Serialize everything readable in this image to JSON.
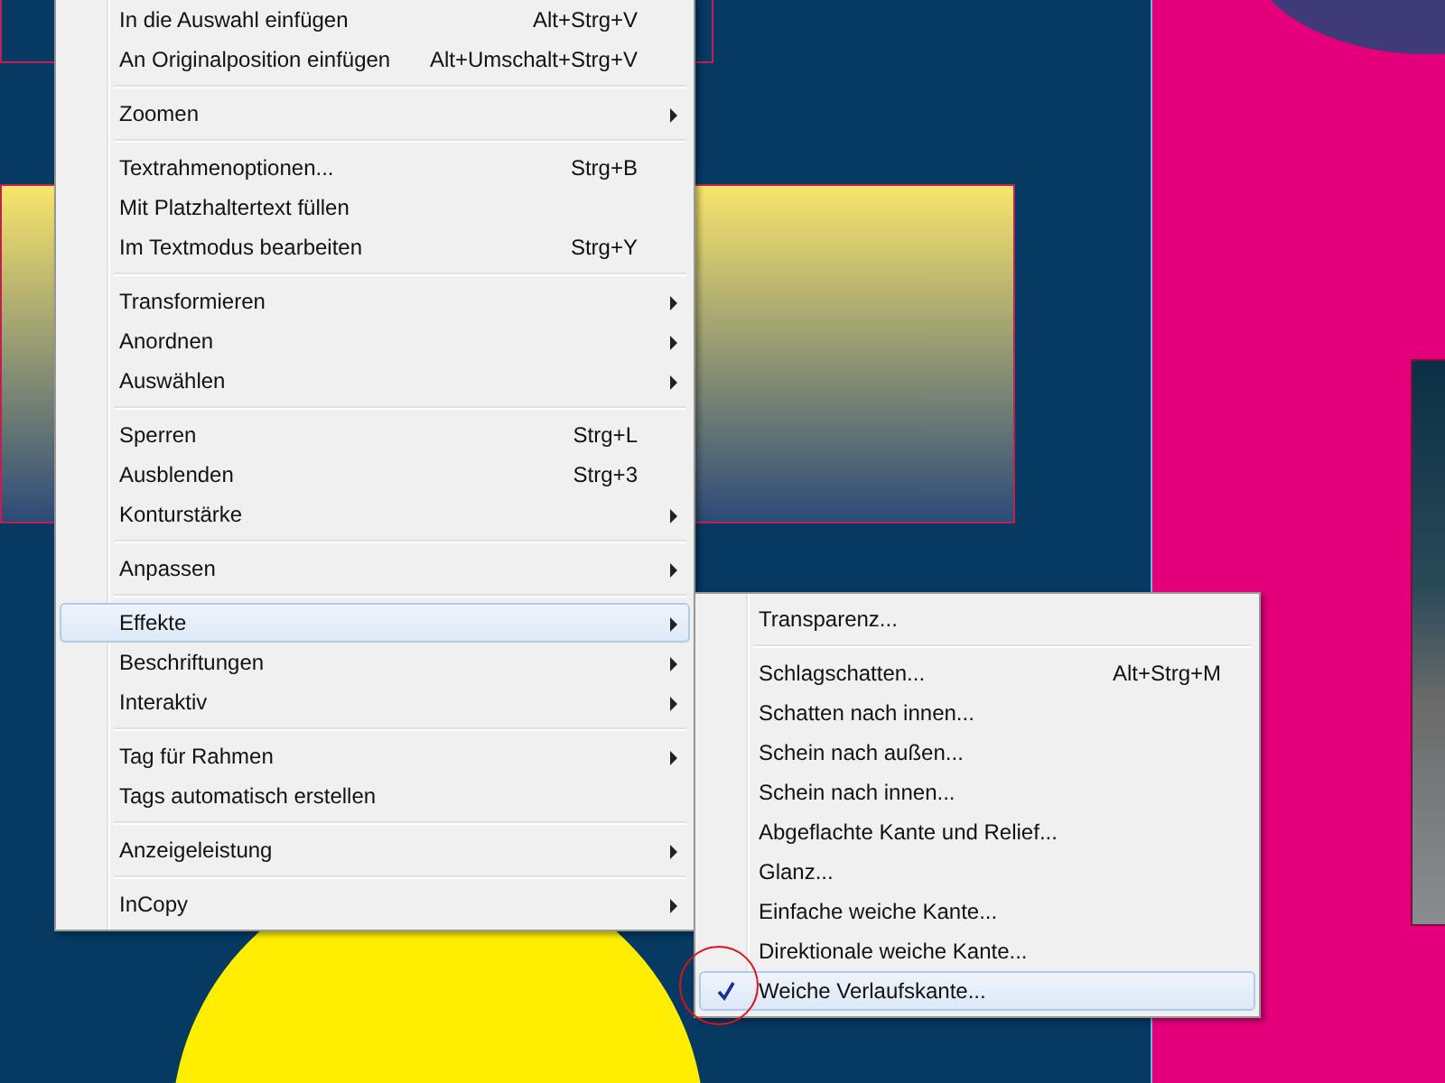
{
  "context_menu": {
    "sections": [
      [
        {
          "label": "In die Auswahl einfügen",
          "shortcut": "Alt+Strg+V",
          "submenu": false,
          "selected": false
        },
        {
          "label": "An Originalposition einfügen",
          "shortcut": "Alt+Umschalt+Strg+V",
          "submenu": false,
          "selected": false
        }
      ],
      [
        {
          "label": "Zoomen",
          "submenu": true,
          "selected": false
        }
      ],
      [
        {
          "label": "Textrahmenoptionen...",
          "shortcut": "Strg+B",
          "submenu": false,
          "selected": false
        },
        {
          "label": "Mit Platzhaltertext füllen",
          "submenu": false,
          "selected": false
        },
        {
          "label": "Im Textmodus bearbeiten",
          "shortcut": "Strg+Y",
          "submenu": false,
          "selected": false
        }
      ],
      [
        {
          "label": "Transformieren",
          "submenu": true,
          "selected": false
        },
        {
          "label": "Anordnen",
          "submenu": true,
          "selected": false
        },
        {
          "label": "Auswählen",
          "submenu": true,
          "selected": false
        }
      ],
      [
        {
          "label": "Sperren",
          "shortcut": "Strg+L",
          "submenu": false,
          "selected": false
        },
        {
          "label": "Ausblenden",
          "shortcut": "Strg+3",
          "submenu": false,
          "selected": false
        },
        {
          "label": "Konturstärke",
          "submenu": true,
          "selected": false
        }
      ],
      [
        {
          "label": "Anpassen",
          "submenu": true,
          "selected": false
        }
      ],
      [
        {
          "label": "Effekte",
          "submenu": true,
          "selected": true
        },
        {
          "label": "Beschriftungen",
          "submenu": true,
          "selected": false
        },
        {
          "label": "Interaktiv",
          "submenu": true,
          "selected": false
        }
      ],
      [
        {
          "label": "Tag für Rahmen",
          "submenu": true,
          "selected": false
        },
        {
          "label": "Tags automatisch erstellen",
          "submenu": false,
          "selected": false
        }
      ],
      [
        {
          "label": "Anzeigeleistung",
          "submenu": true,
          "selected": false
        }
      ],
      [
        {
          "label": "InCopy",
          "submenu": true,
          "selected": false
        }
      ]
    ]
  },
  "effects_submenu": {
    "sections": [
      [
        {
          "label": "Transparenz...",
          "checked": false,
          "selected": false
        }
      ],
      [
        {
          "label": "Schlagschatten...",
          "shortcut": "Alt+Strg+M",
          "checked": false,
          "selected": false
        },
        {
          "label": "Schatten nach innen...",
          "checked": false,
          "selected": false
        },
        {
          "label": "Schein nach außen...",
          "checked": false,
          "selected": false
        },
        {
          "label": "Schein nach innen...",
          "checked": false,
          "selected": false
        },
        {
          "label": "Abgeflachte Kante und Relief...",
          "checked": false,
          "selected": false
        },
        {
          "label": "Glanz...",
          "checked": false,
          "selected": false
        },
        {
          "label": "Einfache weiche Kante...",
          "checked": false,
          "selected": false
        },
        {
          "label": "Direktionale weiche Kante...",
          "checked": false,
          "selected": false
        },
        {
          "label": "Weiche Verlaufskante...",
          "checked": true,
          "selected": true
        }
      ]
    ]
  }
}
